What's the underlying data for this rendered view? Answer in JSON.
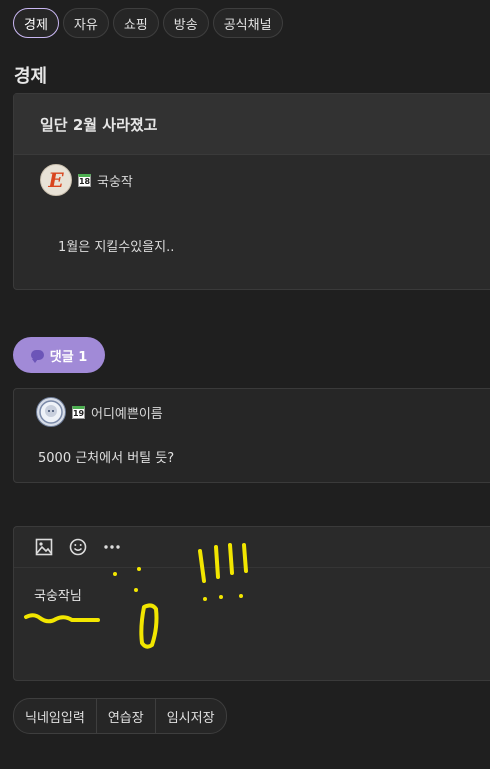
{
  "tabs": [
    {
      "label": "경제",
      "active": true
    },
    {
      "label": "자유",
      "active": false
    },
    {
      "label": "쇼핑",
      "active": false
    },
    {
      "label": "방송",
      "active": false
    },
    {
      "label": "공식채널",
      "active": false
    }
  ],
  "section_title": "경제",
  "post": {
    "title": "일단 2월 사라졌고",
    "author": {
      "level": "18",
      "nickname": "국숭작",
      "avatar_icon": "orange-e-logo-avatar"
    },
    "body": "1월은 지킬수있을지.."
  },
  "comment_button": {
    "label": "댓글 1",
    "icon": "speech-bubble-icon"
  },
  "comments": [
    {
      "level": "19",
      "nickname": "어디예쁜이름",
      "text": "5000 근처에서 버틸 듯?",
      "avatar_icon": "anime-girl-avatar"
    }
  ],
  "editor": {
    "tools": [
      "image-icon",
      "emoji-icon",
      "more-icon"
    ],
    "draft_text": "국숭작님"
  },
  "bottom_buttons": [
    "닉네임입력",
    "연습장",
    "임시저장"
  ],
  "colors": {
    "accent": "#a18ad7",
    "scribble": "#f2e600",
    "background": "#1f1f1f"
  }
}
